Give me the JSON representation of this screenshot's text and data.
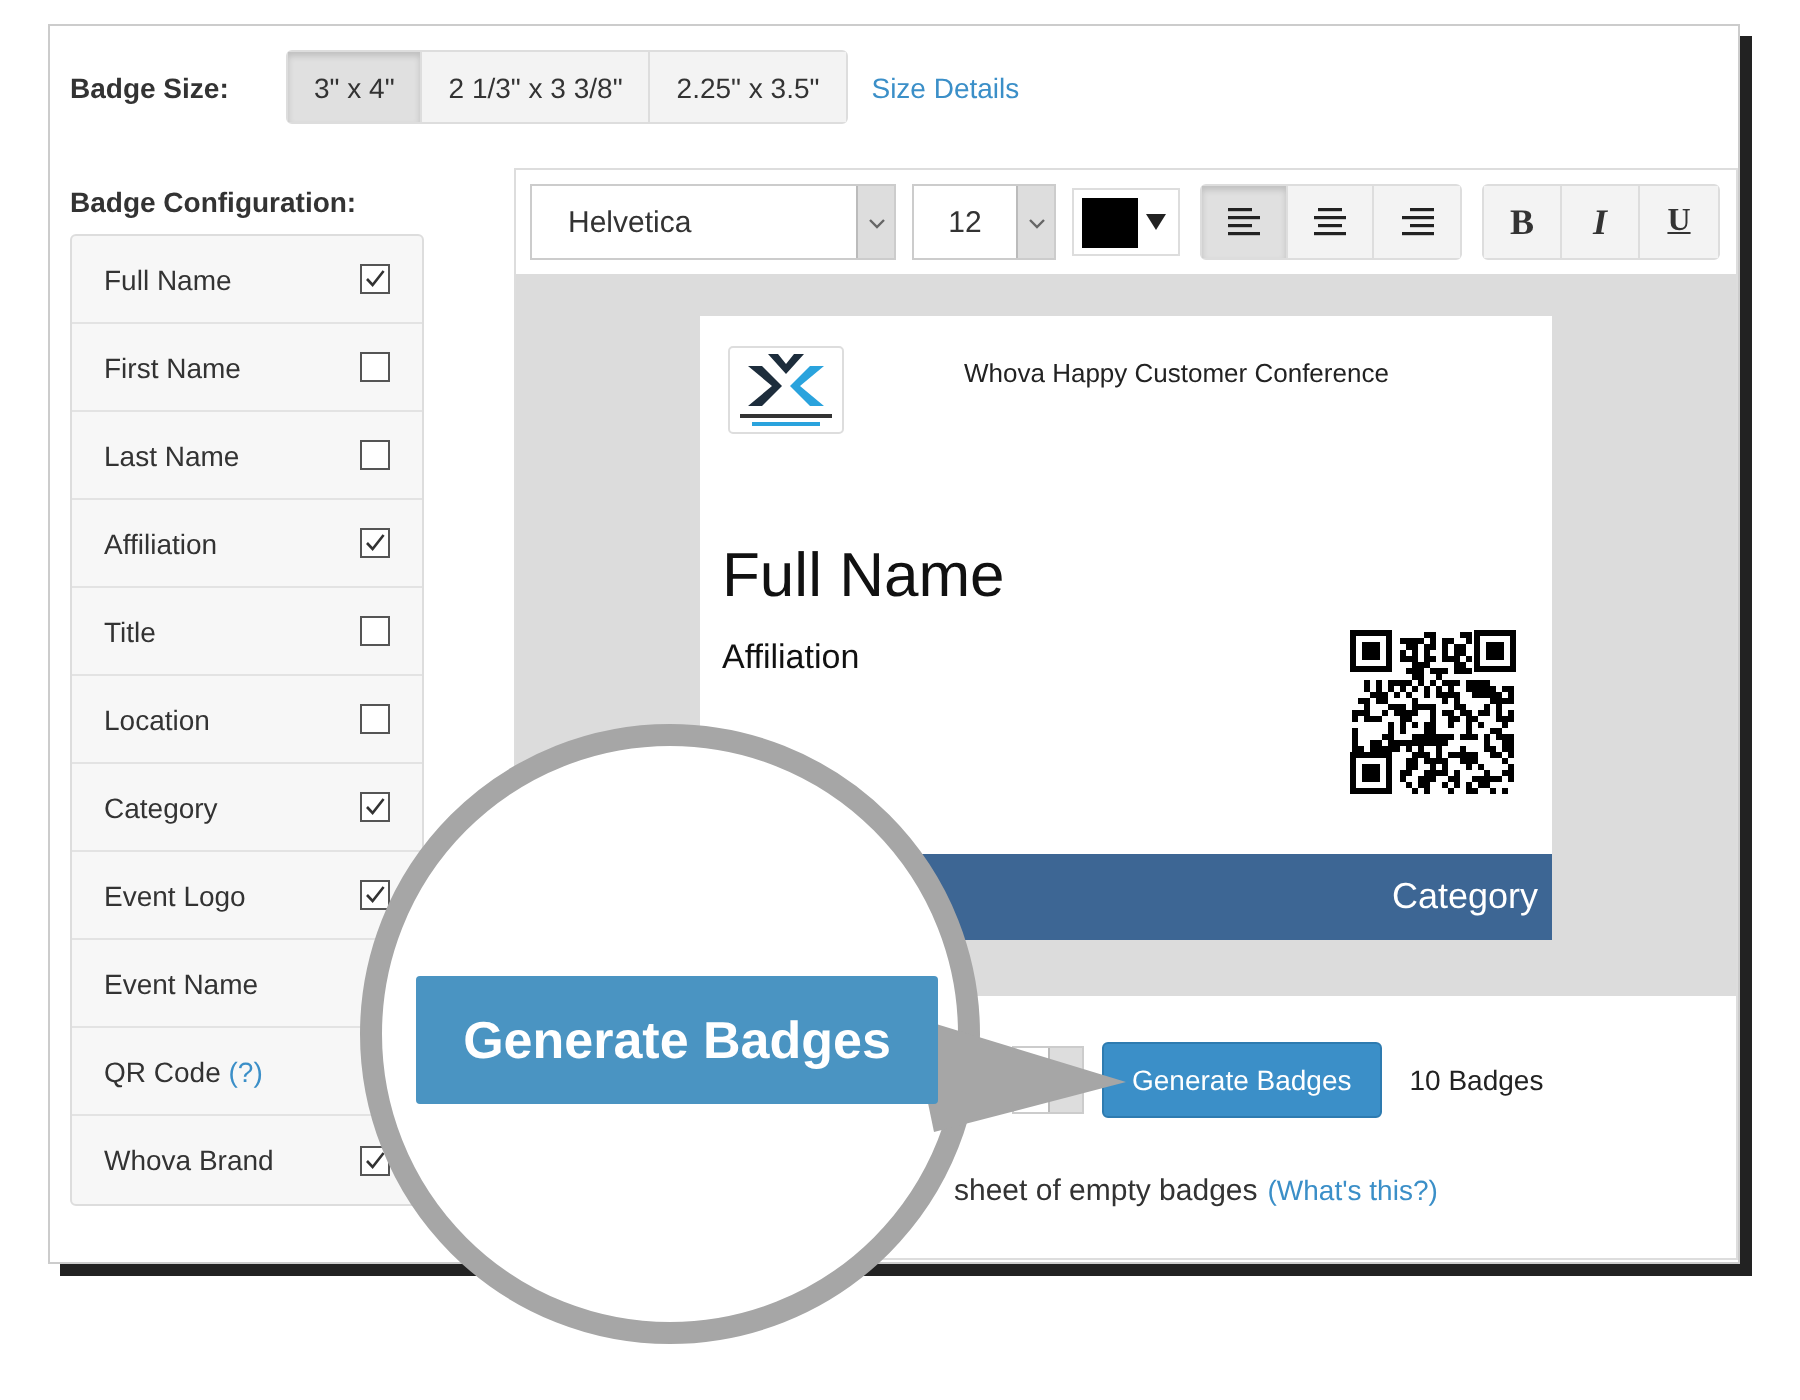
{
  "badge_size": {
    "label": "Badge Size:",
    "options": [
      {
        "label": "3\" x 4\"",
        "selected": true
      },
      {
        "label": "2 1/3\" x 3 3/8\"",
        "selected": false
      },
      {
        "label": "2.25\" x 3.5\"",
        "selected": false
      }
    ],
    "link": "Size Details"
  },
  "configuration": {
    "label": "Badge Configuration:",
    "items": [
      {
        "label": "Full Name",
        "checked": true
      },
      {
        "label": "First Name",
        "checked": false
      },
      {
        "label": "Last Name",
        "checked": false
      },
      {
        "label": "Affiliation",
        "checked": true
      },
      {
        "label": "Title",
        "checked": false
      },
      {
        "label": "Location",
        "checked": false
      },
      {
        "label": "Category",
        "checked": true
      },
      {
        "label": "Event Logo",
        "checked": true
      },
      {
        "label": "Event Name"
      },
      {
        "label": "QR Code",
        "help": "(?)"
      },
      {
        "label": "Whova Brand",
        "checked": true
      }
    ]
  },
  "toolbar": {
    "font": "Helvetica",
    "size": "12",
    "color": "#000000",
    "align": [
      {
        "kind": "left",
        "selected": true
      },
      {
        "kind": "center",
        "selected": false
      },
      {
        "kind": "right",
        "selected": false
      }
    ],
    "styles": [
      {
        "label": "B",
        "kind": "bold"
      },
      {
        "label": "I",
        "kind": "italic"
      },
      {
        "label": "U",
        "kind": "underline"
      }
    ]
  },
  "badge": {
    "event_name": "Whova Happy Customer Conference",
    "full_name": "Full Name",
    "affiliation": "Affiliation",
    "category": "Category"
  },
  "actions": {
    "button": "Generate Badges",
    "count": "10 Badges",
    "sheet_text": "sheet of empty badges",
    "sheet_link": "(What's this?)"
  },
  "magnifier": {
    "button": "Generate Badges"
  }
}
